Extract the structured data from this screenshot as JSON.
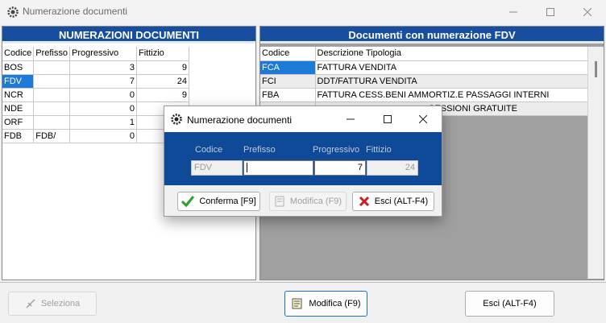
{
  "window": {
    "title": "Numerazione documenti"
  },
  "left_panel": {
    "header": "NUMERAZIONI DOCUMENTI",
    "columns": [
      "Codice",
      "Prefisso",
      "Progressivo",
      "Fittizio"
    ],
    "rows": [
      {
        "codice": "BOS",
        "prefisso": "",
        "progressivo": "3",
        "fittizio": "9"
      },
      {
        "codice": "FDV",
        "prefisso": "",
        "progressivo": "7",
        "fittizio": "24"
      },
      {
        "codice": "NCR",
        "prefisso": "",
        "progressivo": "0",
        "fittizio": "9"
      },
      {
        "codice": "NDE",
        "prefisso": "",
        "progressivo": "0",
        "fittizio": ""
      },
      {
        "codice": "ORF",
        "prefisso": "",
        "progressivo": "1",
        "fittizio": ""
      },
      {
        "codice": "FDB",
        "prefisso": "FDB/",
        "progressivo": "0",
        "fittizio": ""
      }
    ]
  },
  "right_panel": {
    "header": "Documenti con numerazione FDV",
    "columns": [
      "Codice",
      "Descrizione Tipologia"
    ],
    "rows": [
      {
        "codice": "FCA",
        "descrizione": "FATTURA VENDITA"
      },
      {
        "codice": "FCI",
        "descrizione": "DDT/FATTURA VENDITA"
      },
      {
        "codice": "FBA",
        "descrizione": "FATTURA CESS.BENI AMMORTIZ.E PASSAGGI INTERNI"
      },
      {
        "codice": "",
        "descrizione": "CESSIONI GRATUITE"
      }
    ]
  },
  "bottom_bar": {
    "seleziona": "Seleziona",
    "modifica": "Modifica (F9)",
    "esci": "Esci (ALT-F4)"
  },
  "dialog": {
    "title": "Numerazione documenti",
    "labels": {
      "codice": "Codice",
      "prefisso": "Prefisso",
      "progressivo": "Progressivo",
      "fittizio": "Fittizio"
    },
    "values": {
      "codice": "FDV",
      "prefisso": "",
      "progressivo": "7",
      "fittizio": "24"
    },
    "buttons": {
      "conferma": "Conferma [F9]",
      "modifica": "Modifica (F9)",
      "esci": "Esci (ALT-F4)"
    }
  },
  "icons": {
    "app": "gear-icon",
    "confirm": "checkmark-icon",
    "cancel": "red-x-icon",
    "edit": "notepad-icon",
    "select": "pointer-icon"
  },
  "colors": {
    "header_blue": "#174ea0",
    "selection": "#1e7ad8",
    "dialog_blue": "#0f4a98"
  }
}
